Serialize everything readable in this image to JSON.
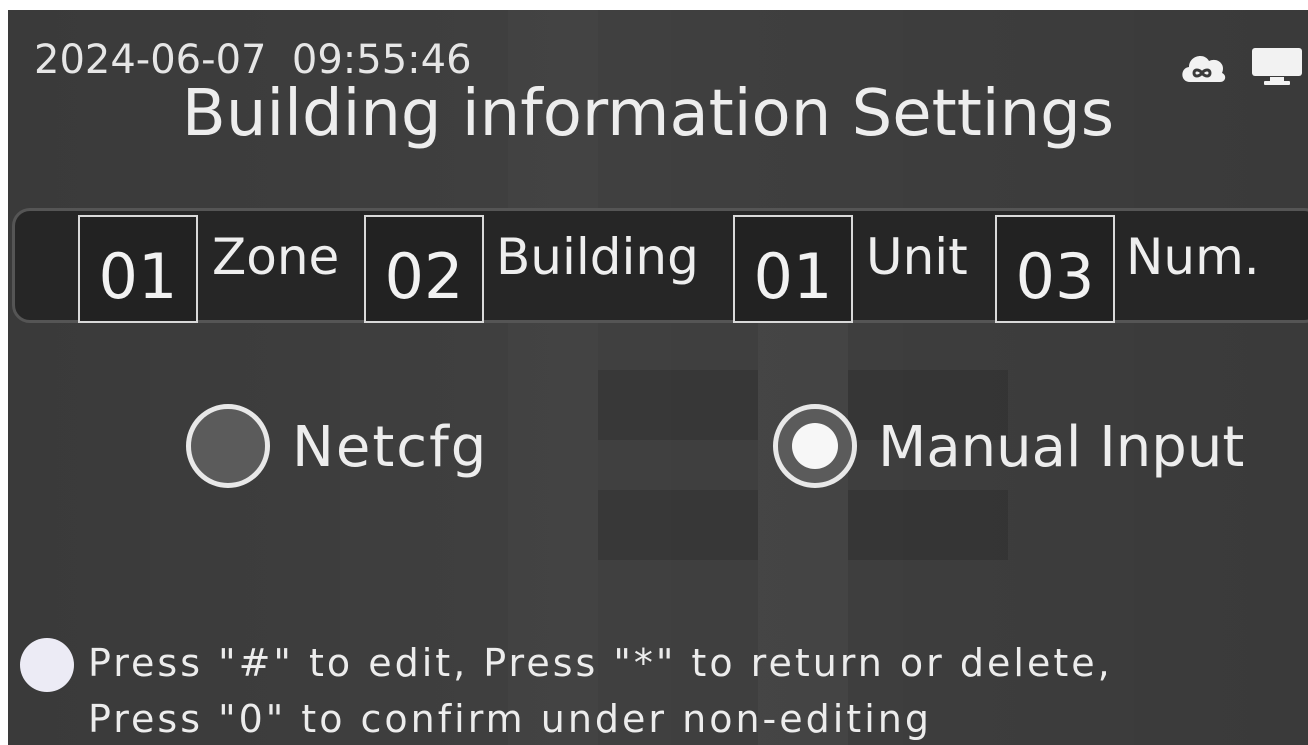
{
  "header": {
    "datetime": "2024-06-07  09:55:46",
    "title": "Building information Settings",
    "status_icons": [
      "cloud-link-icon",
      "monitor-icon"
    ]
  },
  "address": {
    "zone_value": "01",
    "zone_label": "Zone",
    "building_value": "02",
    "building_label": "Building",
    "unit_value": "01",
    "unit_label": "Unit",
    "num_value": "03",
    "num_label": "Num."
  },
  "mode": {
    "options": [
      {
        "label": "Netcfg",
        "selected": false
      },
      {
        "label": "Manual Input",
        "selected": true
      }
    ]
  },
  "hint": {
    "line1": "Press \"#\" to edit, Press \"*\" to return or delete,",
    "line2": "Press \"0\" to confirm under non-editing"
  },
  "colors": {
    "background": "#3a3a3a",
    "text": "#ededed",
    "field_border": "#d9d9d9"
  }
}
